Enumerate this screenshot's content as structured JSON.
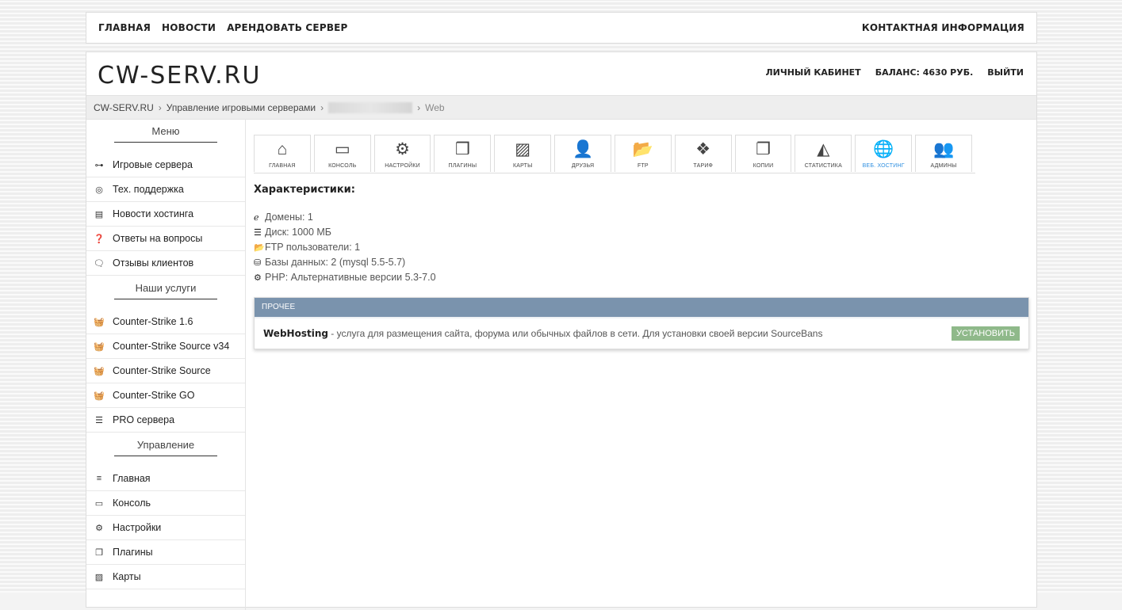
{
  "topnav": {
    "links": [
      "ГЛАВНАЯ",
      "НОВОСТИ",
      "АРЕНДОВАТЬ СЕРВЕР"
    ],
    "contact": "КОНТАКТНАЯ ИНФОРМАЦИЯ"
  },
  "header": {
    "logo": "CW-SERV.RU",
    "cabinet": "ЛИЧНЫЙ КАБИНЕТ",
    "balance": "БАЛАНС: 4630 РУБ.",
    "logout": "ВЫЙТИ"
  },
  "breadcrumb": {
    "home": "CW-SERV.RU",
    "section": "Управление игровыми серверами",
    "current": "Web"
  },
  "sidebar": {
    "menu_title": "Меню",
    "menu": [
      {
        "label": "Игровые сервера",
        "icon": "gamepad-icon"
      },
      {
        "label": "Тех. поддержка",
        "icon": "lifebuoy-icon"
      },
      {
        "label": "Новости хостинга",
        "icon": "newspaper-icon"
      },
      {
        "label": "Ответы на вопросы",
        "icon": "question-icon"
      },
      {
        "label": "Отзывы клиентов",
        "icon": "comments-icon"
      }
    ],
    "services_title": "Наши услуги",
    "services": [
      {
        "label": "Counter-Strike 1.6",
        "icon": "basket-icon"
      },
      {
        "label": "Counter-Strike Source v34",
        "icon": "basket-icon"
      },
      {
        "label": "Counter-Strike Source",
        "icon": "basket-icon"
      },
      {
        "label": "Counter-Strike GO",
        "icon": "basket-icon"
      },
      {
        "label": "PRO сервера",
        "icon": "server-icon"
      }
    ],
    "manage_title": "Управление",
    "manage": [
      {
        "label": "Главная",
        "icon": "bars-icon"
      },
      {
        "label": "Консоль",
        "icon": "monitor-icon"
      },
      {
        "label": "Настройки",
        "icon": "gear-icon"
      },
      {
        "label": "Плагины",
        "icon": "cubes-icon"
      },
      {
        "label": "Карты",
        "icon": "image-icon"
      }
    ]
  },
  "tabs": [
    {
      "label": "ГЛАВНАЯ",
      "icon": "home-icon"
    },
    {
      "label": "КОНСОЛЬ",
      "icon": "monitor-icon"
    },
    {
      "label": "НАСТРОЙКИ",
      "icon": "gear-icon"
    },
    {
      "label": "ПЛАГИНЫ",
      "icon": "cubes-icon"
    },
    {
      "label": "КАРТЫ",
      "icon": "image-icon"
    },
    {
      "label": "ДРУЗЬЯ",
      "icon": "user-plus-icon"
    },
    {
      "label": "FTP",
      "icon": "folder-icon"
    },
    {
      "label": "ТАРИФ",
      "icon": "dropbox-icon"
    },
    {
      "label": "КОПИИ",
      "icon": "copy-icon"
    },
    {
      "label": "СТАТИСТИКА",
      "icon": "area-chart-icon"
    },
    {
      "label": "ВЕБ. ХОСТИНГ",
      "icon": "globe-icon",
      "active": true
    },
    {
      "label": "АДМИНЫ",
      "icon": "users-icon"
    }
  ],
  "specs": {
    "title": "Характеристики:",
    "rows": [
      {
        "icon": "ie-icon",
        "text": "Домены: 1"
      },
      {
        "icon": "server-icon",
        "text": "Диск: 1000 МБ"
      },
      {
        "icon": "folder-open-icon",
        "text": "FTP пользователи: 1"
      },
      {
        "icon": "database-icon",
        "text": "Базы данных: 2 (mysql 5.5-5.7)"
      },
      {
        "icon": "gears-icon",
        "text": "PHP: Альтернативные версии 5.3-7.0"
      }
    ]
  },
  "panel": {
    "header": "ПРОЧЕЕ",
    "item_name": "WebHosting",
    "item_desc": " - услуга для размещения сайта, форума или обычных файлов в сети. Для установки своей версии SourceBans",
    "install_label": "УСТАНОВИТЬ"
  },
  "colors": {
    "accent": "#2f8fe0",
    "panel_header": "#7a93ad",
    "install_button": "#8fb98a"
  }
}
